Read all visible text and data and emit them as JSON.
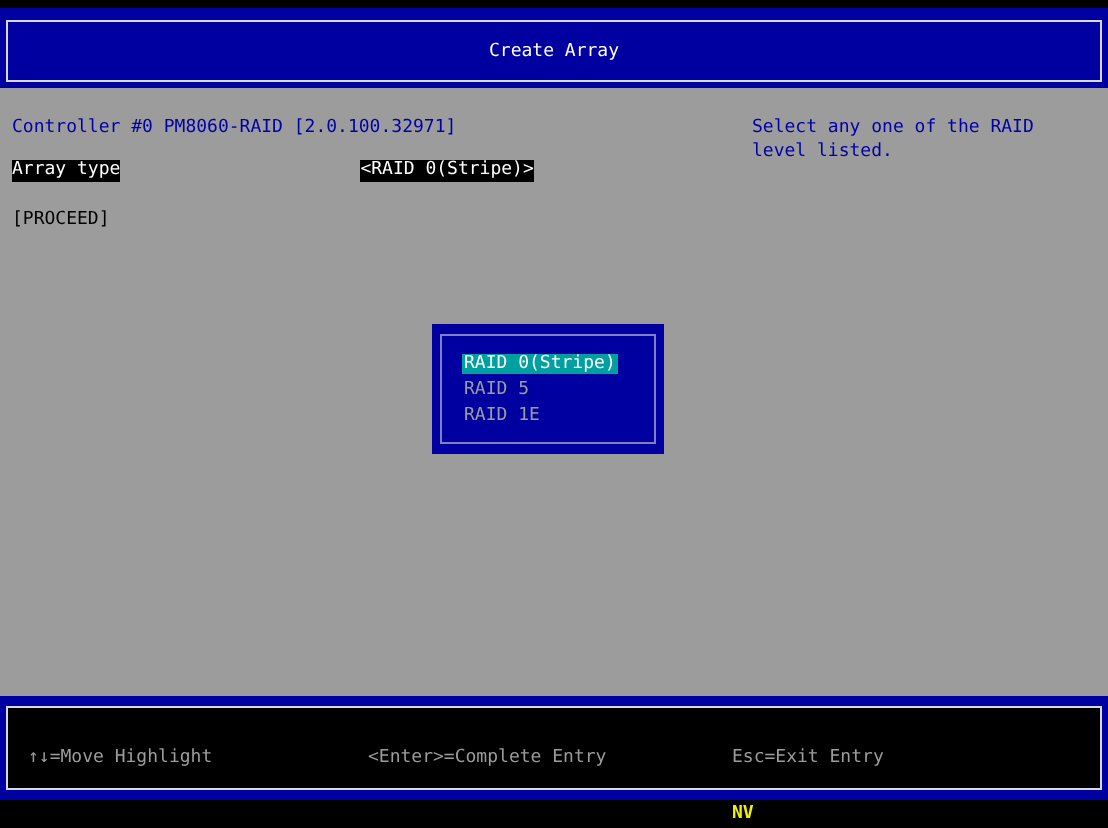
{
  "window": {
    "title": "Create Array"
  },
  "controller": "Controller #0 PM8060-RAID [2.0.100.32971]",
  "help": "Select any one of the RAID level listed.",
  "fields": [
    {
      "label": "Array type",
      "value": "<RAID 0(Stripe)>",
      "selected": true
    }
  ],
  "proceed": {
    "label": "[PROCEED]",
    "selected": false
  },
  "popup": {
    "items": [
      {
        "label": "RAID 0(Stripe)",
        "selected": true
      },
      {
        "label": "RAID 5",
        "selected": false
      },
      {
        "label": "RAID 1E",
        "selected": false
      }
    ]
  },
  "footer": [
    "↑↓=Move Highlight",
    "<Enter>=Complete Entry",
    "Esc=Exit Entry"
  ],
  "status": "NV"
}
